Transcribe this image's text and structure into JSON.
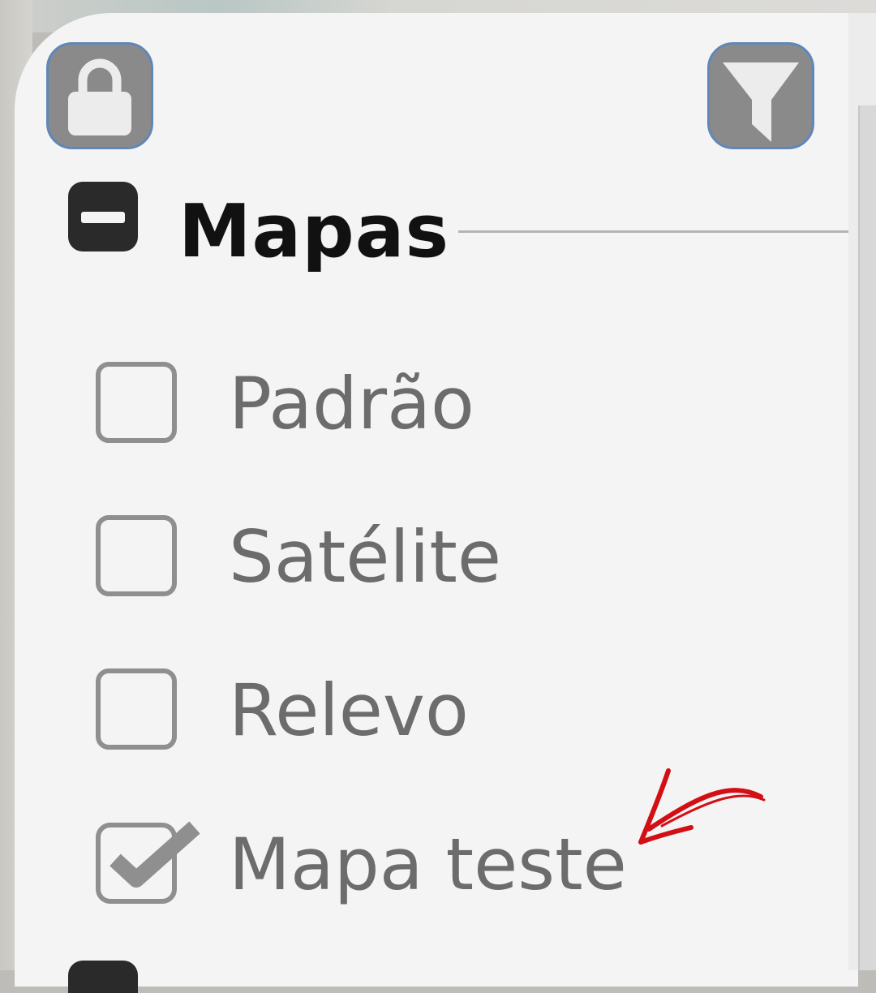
{
  "toolbar": {
    "lock_icon": "lock-icon",
    "filter_icon": "filter-icon",
    "button_fill": "#8a8a8a",
    "button_border": "#5f87b8"
  },
  "section": {
    "title": "Mapas",
    "collapse_icon": "minus-square-icon"
  },
  "layers": [
    {
      "label": "Padrão",
      "checked": false
    },
    {
      "label": "Satélite",
      "checked": false
    },
    {
      "label": "Relevo",
      "checked": false
    },
    {
      "label": "Mapa teste",
      "checked": true
    }
  ],
  "annotation": {
    "icon": "red-arrow-icon",
    "color": "#d30f16"
  }
}
